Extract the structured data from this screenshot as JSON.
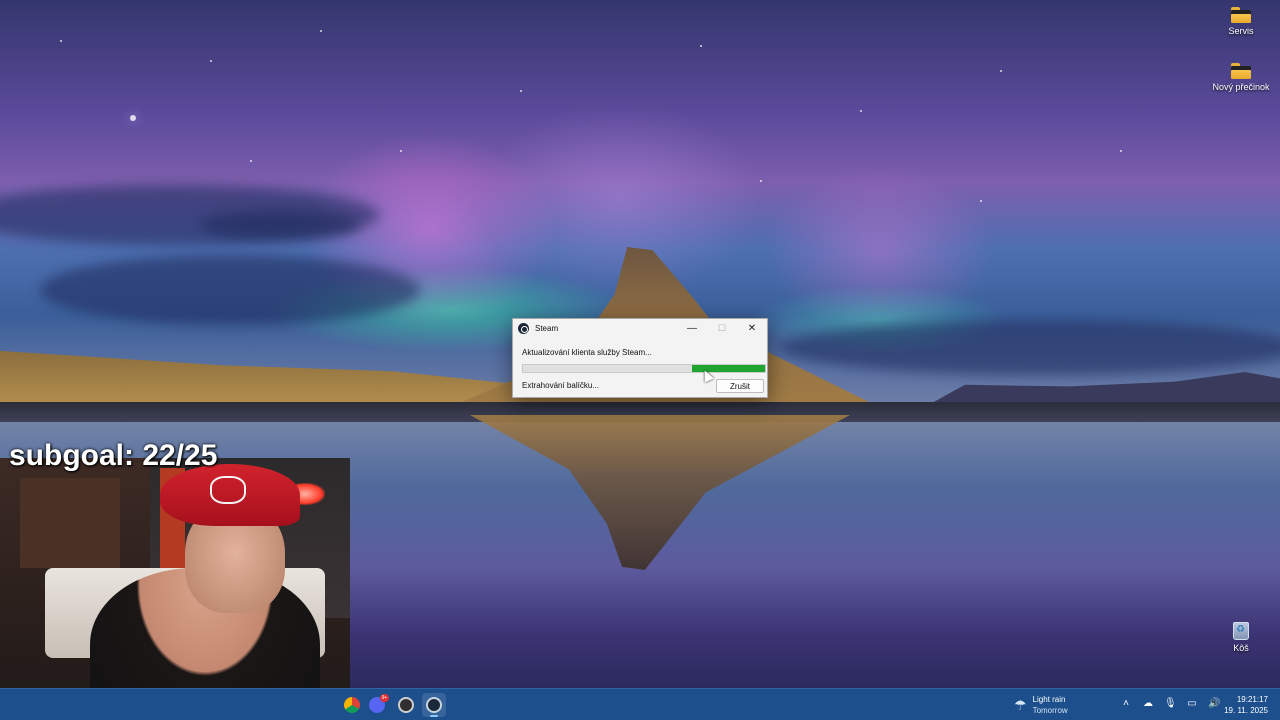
{
  "desktop": {
    "icons": [
      {
        "label": "Servis",
        "icon": "folder-icon"
      },
      {
        "label": "Nový přečinok",
        "icon": "folder-icon"
      },
      {
        "label": "Kôš",
        "icon": "recycle-bin-icon"
      }
    ]
  },
  "dialog": {
    "title": "Steam",
    "message": "Aktualizování klienta služby Steam...",
    "status": "Extrahování balíčku...",
    "cancel_label": "Zrušit",
    "progress": 0.3,
    "progress_color": "#1fa331",
    "controls": {
      "minimize": "—",
      "maximize": "☐",
      "close": "✕"
    }
  },
  "overlay": {
    "subgoal": "subgoal: 22/25"
  },
  "taskbar": {
    "apps": [
      {
        "name": "chrome-icon",
        "color": "#f4b400"
      },
      {
        "name": "discord-icon",
        "color": "#5865f2",
        "badge": "9+"
      },
      {
        "name": "obs-icon",
        "color": "#302e31"
      },
      {
        "name": "steam-icon",
        "color": "#1b2838",
        "active": true
      }
    ],
    "weather": {
      "line1": "Light rain",
      "line2": "Tomorrow",
      "icon": "rain-umbrella-icon"
    },
    "tray_icons": [
      "chevron-up-icon",
      "onedrive-icon",
      "microphone-icon",
      "network-icon",
      "volume-icon"
    ],
    "clock": {
      "time": "19:21:17",
      "date": "19. 11. 2025"
    }
  }
}
